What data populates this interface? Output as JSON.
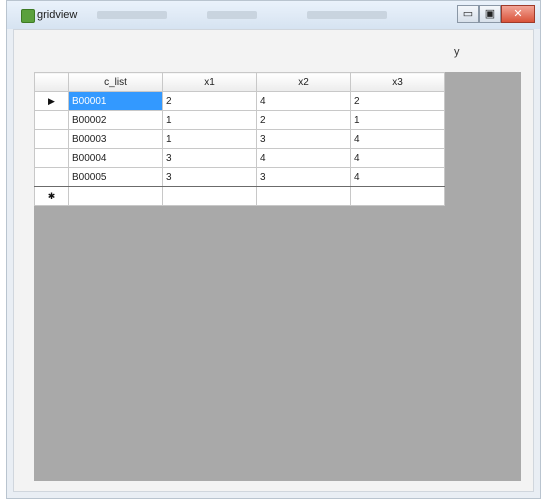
{
  "window": {
    "title": "gridview",
    "controls": {
      "minimize": "▭",
      "maximize": "▣",
      "close": "✕"
    }
  },
  "form": {
    "mark": "y"
  },
  "grid": {
    "columns": [
      "c_list",
      "x1",
      "x2",
      "x3"
    ],
    "rows": [
      {
        "indicator": "▶",
        "cells": [
          "B00001",
          "2",
          "4",
          "2"
        ]
      },
      {
        "indicator": "",
        "cells": [
          "B00002",
          "1",
          "2",
          "1"
        ]
      },
      {
        "indicator": "",
        "cells": [
          "B00003",
          "1",
          "3",
          "4"
        ]
      },
      {
        "indicator": "",
        "cells": [
          "B00004",
          "3",
          "4",
          "4"
        ]
      },
      {
        "indicator": "",
        "cells": [
          "B00005",
          "3",
          "3",
          "4"
        ]
      },
      {
        "indicator": "✱",
        "cells": [
          "",
          "",
          "",
          ""
        ]
      }
    ]
  }
}
